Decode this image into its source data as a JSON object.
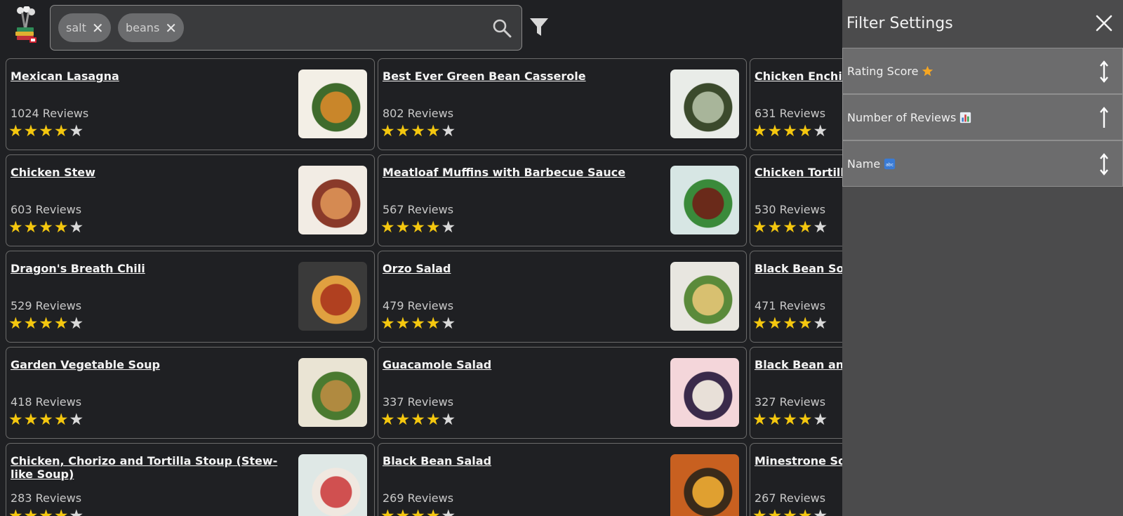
{
  "search": {
    "chips": [
      {
        "label": "salt"
      },
      {
        "label": "beans"
      }
    ]
  },
  "panel": {
    "title": "Filter Settings",
    "options": [
      {
        "label": "Rating Score",
        "icon": "star-emoji-icon",
        "sort": "bidirectional"
      },
      {
        "label": "Number of Reviews",
        "icon": "bar-chart-emoji-icon",
        "sort": "ascending"
      },
      {
        "label": "Name",
        "icon": "abc-emoji-icon",
        "sort": "bidirectional"
      }
    ]
  },
  "recipes": [
    {
      "title": "Mexican Lasagna",
      "reviews": "1024 Reviews",
      "rating": 4
    },
    {
      "title": "Best Ever Green Bean Casserole",
      "reviews": "802 Reviews",
      "rating": 4
    },
    {
      "title": "Chicken Enchiladas with Chile Salsa",
      "reviews": "631 Reviews",
      "rating": 4
    },
    {
      "title": "Chicken Stew",
      "reviews": "603 Reviews",
      "rating": 4
    },
    {
      "title": "Meatloaf Muffins with Barbecue Sauce",
      "reviews": "567 Reviews",
      "rating": 4
    },
    {
      "title": "Chicken Tortilla Soup",
      "reviews": "530 Reviews",
      "rating": 4
    },
    {
      "title": "Dragon's Breath Chili",
      "reviews": "529 Reviews",
      "rating": 4
    },
    {
      "title": "Orzo Salad",
      "reviews": "479 Reviews",
      "rating": 4
    },
    {
      "title": "Black Bean Soup",
      "reviews": "471 Reviews",
      "rating": 4
    },
    {
      "title": "Garden Vegetable Soup",
      "reviews": "418 Reviews",
      "rating": 4
    },
    {
      "title": "Guacamole Salad",
      "reviews": "337 Reviews",
      "rating": 4
    },
    {
      "title": "Black Bean and Corn Salad",
      "reviews": "327 Reviews",
      "rating": 4
    },
    {
      "title": "Chicken, Chorizo and Tortilla Stoup (Stew-like Soup)",
      "reviews": "283 Reviews",
      "rating": 4
    },
    {
      "title": "Black Bean Salad",
      "reviews": "269 Reviews",
      "rating": 4
    },
    {
      "title": "Minestrone Soup",
      "reviews": "267 Reviews",
      "rating": 4
    }
  ],
  "colors": {
    "background": "#1f2023",
    "star_on": "#f4c70f",
    "star_off": "#d9d9d9",
    "panel": "#4b4b4c"
  }
}
